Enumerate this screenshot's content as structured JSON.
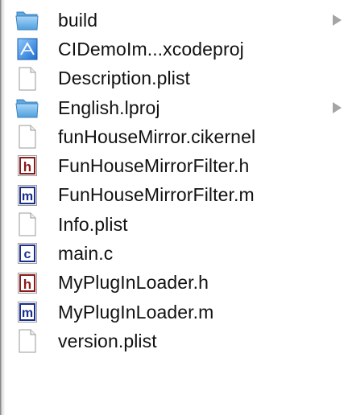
{
  "files": [
    {
      "name": "build",
      "icon": "folder-icon",
      "disclosure": true
    },
    {
      "name": "CIDemoIm...xcodeproj",
      "icon": "xcode-project-icon",
      "disclosure": false
    },
    {
      "name": "Description.plist",
      "icon": "document-icon",
      "disclosure": false
    },
    {
      "name": "English.lproj",
      "icon": "folder-icon",
      "disclosure": true
    },
    {
      "name": "funHouseMirror.cikernel",
      "icon": "document-icon",
      "disclosure": false
    },
    {
      "name": "FunHouseMirrorFilter.h",
      "icon": "header-file-icon",
      "badge": "h",
      "disclosure": false
    },
    {
      "name": "FunHouseMirrorFilter.m",
      "icon": "objc-file-icon",
      "badge": "m",
      "disclosure": false
    },
    {
      "name": "Info.plist",
      "icon": "document-icon",
      "disclosure": false
    },
    {
      "name": "main.c",
      "icon": "c-file-icon",
      "badge": "c",
      "disclosure": false
    },
    {
      "name": "MyPlugInLoader.h",
      "icon": "header-file-icon",
      "badge": "h",
      "disclosure": false
    },
    {
      "name": "MyPlugInLoader.m",
      "icon": "objc-file-icon",
      "badge": "m",
      "disclosure": false
    },
    {
      "name": "version.plist",
      "icon": "document-icon",
      "disclosure": false
    }
  ],
  "colors": {
    "folder": "#6fb6ea",
    "header_badge": "#8b1a1a",
    "objc_badge": "#1a2f8c",
    "c_badge": "#1a2f8c",
    "disclosure_arrow": "#a5a5a5"
  }
}
